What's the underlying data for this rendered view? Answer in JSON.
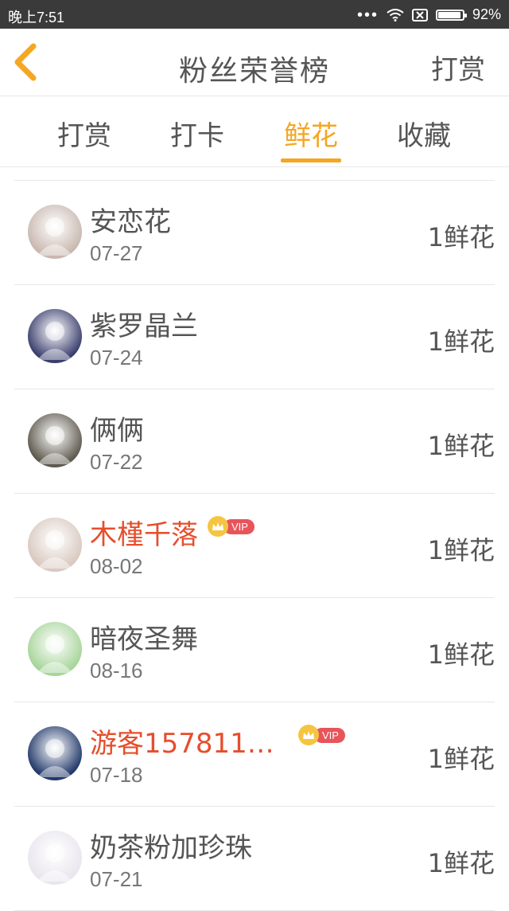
{
  "status_bar": {
    "time": "晚上7:51",
    "battery": "92%",
    "battery_level": 0.92
  },
  "nav": {
    "title": "粉丝荣誉榜",
    "action": "打赏"
  },
  "tabs": [
    {
      "label": "打赏",
      "active": false
    },
    {
      "label": "打卡",
      "active": false
    },
    {
      "label": "鲜花",
      "active": true
    },
    {
      "label": "收藏",
      "active": false
    }
  ],
  "colors": {
    "accent": "#f5a623",
    "vip_name": "#e64e2c",
    "text": "#555555"
  },
  "fans": [
    {
      "name": "安恋花",
      "date": "07-27",
      "amount": "1鲜花",
      "vip": false,
      "avatar_color": "#c9b8b0"
    },
    {
      "name": "紫罗晶兰",
      "date": "07-24",
      "amount": "1鲜花",
      "vip": false,
      "avatar_color": "#3b3f6e"
    },
    {
      "name": "俩俩",
      "date": "07-22",
      "amount": "1鲜花",
      "vip": false,
      "avatar_color": "#5f5a4f"
    },
    {
      "name": "木槿千落",
      "date": "08-02",
      "amount": "1鲜花",
      "vip": true,
      "vip_label": "VIP",
      "avatar_color": "#d9c9c0"
    },
    {
      "name": "暗夜圣舞",
      "date": "08-16",
      "amount": "1鲜花",
      "vip": false,
      "avatar_color": "#a7d59a"
    },
    {
      "name": "游客1578110...",
      "date": "07-18",
      "amount": "1鲜花",
      "vip": true,
      "vip_label": "VIP",
      "avatar_color": "#233a6b"
    },
    {
      "name": "奶茶粉加珍珠",
      "date": "07-21",
      "amount": "1鲜花",
      "vip": false,
      "avatar_color": "#e9e6ee"
    }
  ]
}
